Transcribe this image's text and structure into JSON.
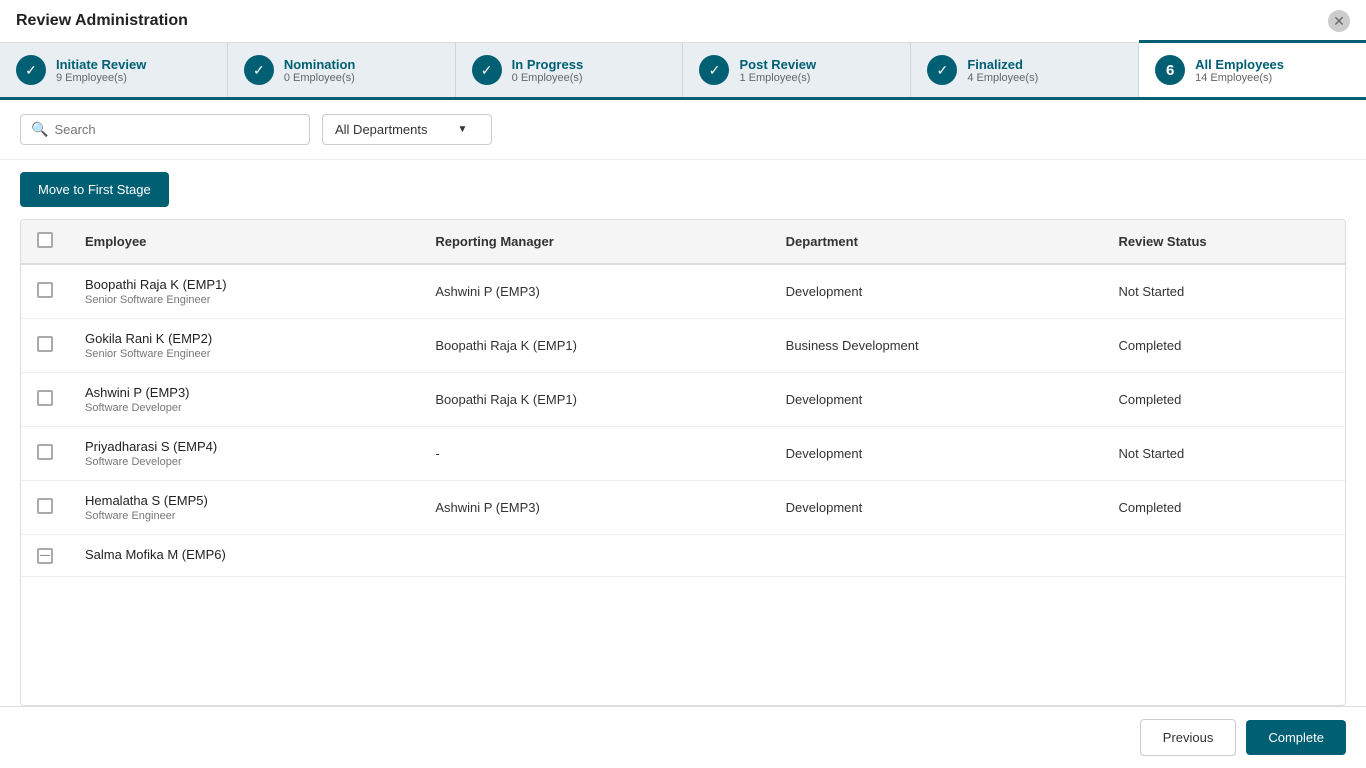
{
  "window": {
    "title": "Review Administration"
  },
  "stages": [
    {
      "id": "initiate-review",
      "name": "Initiate Review",
      "count": "9 Employee(s)",
      "icon": "check",
      "type": "check"
    },
    {
      "id": "nomination",
      "name": "Nomination",
      "count": "0 Employee(s)",
      "icon": "check",
      "type": "check"
    },
    {
      "id": "in-progress",
      "name": "In Progress",
      "count": "0 Employee(s)",
      "icon": "check",
      "type": "check"
    },
    {
      "id": "post-review",
      "name": "Post Review",
      "count": "1 Employee(s)",
      "icon": "check",
      "type": "check"
    },
    {
      "id": "finalized",
      "name": "Finalized",
      "count": "4 Employee(s)",
      "icon": "check",
      "type": "check"
    },
    {
      "id": "all-employees",
      "name": "All Employees",
      "count": "14 Employee(s)",
      "icon": "6",
      "type": "number",
      "active": true
    }
  ],
  "toolbar": {
    "search_placeholder": "Search",
    "department_label": "All Departments"
  },
  "actions": {
    "move_label": "Move to First Stage"
  },
  "table": {
    "headers": [
      "",
      "Employee",
      "Reporting Manager",
      "Department",
      "Review Status"
    ],
    "rows": [
      {
        "id": "emp1",
        "name": "Boopathi Raja K (EMP1)",
        "title": "Senior Software Engineer",
        "manager": "Ashwini P (EMP3)",
        "department": "Development",
        "status": "Not Started",
        "checked": false,
        "indeterminate": false
      },
      {
        "id": "emp2",
        "name": "Gokila Rani K (EMP2)",
        "title": "Senior Software Engineer",
        "manager": "Boopathi Raja K (EMP1)",
        "department": "Business Development",
        "status": "Completed",
        "checked": false,
        "indeterminate": false
      },
      {
        "id": "emp3",
        "name": "Ashwini P (EMP3)",
        "title": "Software Developer",
        "manager": "Boopathi Raja K (EMP1)",
        "department": "Development",
        "status": "Completed",
        "checked": false,
        "indeterminate": false
      },
      {
        "id": "emp4",
        "name": "Priyadharasi S (EMP4)",
        "title": "Software Developer",
        "manager": "-",
        "department": "Development",
        "status": "Not Started",
        "checked": false,
        "indeterminate": false
      },
      {
        "id": "emp5",
        "name": "Hemalatha S (EMP5)",
        "title": "Software Engineer",
        "manager": "Ashwini P (EMP3)",
        "department": "Development",
        "status": "Completed",
        "checked": false,
        "indeterminate": false
      },
      {
        "id": "emp6",
        "name": "Salma Mofika M (EMP6)",
        "title": "",
        "manager": "",
        "department": "",
        "status": "",
        "checked": false,
        "indeterminate": true
      }
    ]
  },
  "footer": {
    "previous_label": "Previous",
    "complete_label": "Complete"
  }
}
